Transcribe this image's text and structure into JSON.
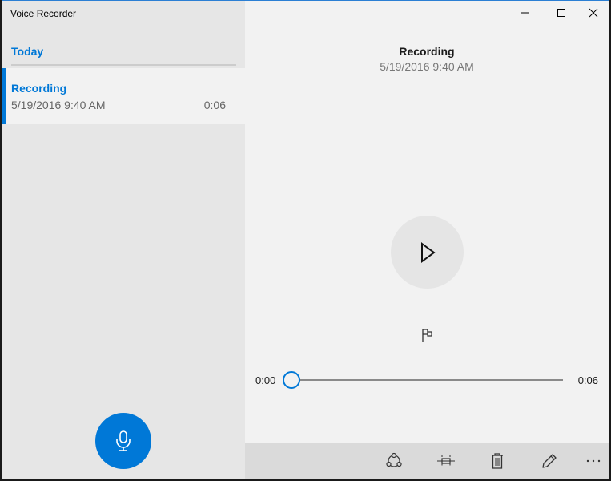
{
  "window": {
    "title": "Voice Recorder",
    "controls": {
      "minimize": "minimize-icon",
      "maximize": "maximize-icon",
      "close": "close-icon"
    }
  },
  "sidebar": {
    "group_header": "Today",
    "recordings": [
      {
        "name": "Recording",
        "date": "5/19/2016 9:40 AM",
        "duration": "0:06",
        "selected": true
      }
    ],
    "record_button_icon": "microphone-icon"
  },
  "detail": {
    "title": "Recording",
    "date": "5/19/2016 9:40 AM",
    "play_icon": "play-icon",
    "marker_icon": "flag-icon",
    "playback": {
      "current_time": "0:00",
      "total_time": "0:06",
      "progress": 0
    }
  },
  "command_bar": {
    "buttons": [
      {
        "name": "share",
        "icon": "share-icon"
      },
      {
        "name": "trim",
        "icon": "trim-icon"
      },
      {
        "name": "delete",
        "icon": "trash-icon"
      },
      {
        "name": "rename",
        "icon": "pencil-icon"
      },
      {
        "name": "more",
        "icon": "more-icon"
      }
    ]
  },
  "colors": {
    "accent": "#0078d7",
    "sidebar_bg": "#e6e6e6",
    "main_bg": "#f2f2f2",
    "command_bar_bg": "#dadada"
  }
}
